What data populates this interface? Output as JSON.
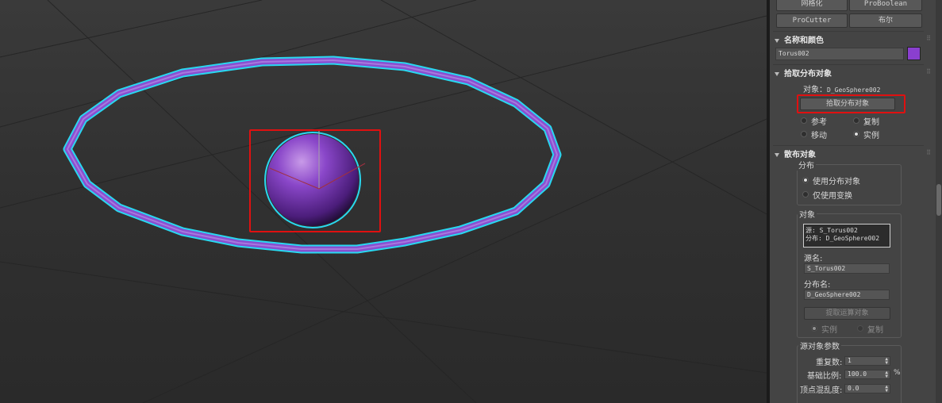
{
  "colors": {
    "viewport_bg": "#333333",
    "panel_bg": "#444444",
    "torus_fill": "#8a4fcf",
    "selection_cyan": "#29d8f0",
    "highlight_red": "#e01010",
    "swatch_purple": "#8a3fcf"
  },
  "top_buttons": {
    "mesh_label": "网格化",
    "proboolean_label": "ProBoolean",
    "procutter_label": "ProCutter",
    "boolean_label": "布尔"
  },
  "name_color": {
    "title": "名称和颜色",
    "object_name": "Torus002"
  },
  "pick_distribution": {
    "title": "拾取分布对象",
    "object_label": "对象：",
    "object_value": "D_GeoSphere002",
    "pick_button": "拾取分布对象",
    "reference_label": "参考",
    "copy_label": "复制",
    "move_label": "移动",
    "instance_label": "实例"
  },
  "scatter_objects": {
    "title": "散布对象",
    "distribution_group": "分布",
    "use_distribution_object": "使用分布对象",
    "use_transforms_only": "仅使用变换",
    "objects_group": "对象",
    "list_line_1": "源: S_Torus002",
    "list_line_2": "分布: D_GeoSphere002",
    "source_name_label": "源名:",
    "source_name_value": "S_Torus002",
    "distribution_name_label": "分布名:",
    "distribution_name_value": "D_GeoSphere002",
    "extract_operand_button": "提取运算对象",
    "instance_label": "实例",
    "copy_label": "复制"
  },
  "source_params": {
    "title": "源对象参数",
    "duplicates_label": "重复数:",
    "duplicates_value": "1",
    "base_scale_label": "基础比例:",
    "base_scale_value": "100.0",
    "base_scale_unit": "%",
    "vertex_chaos_label": "顶点混乱度:",
    "vertex_chaos_value": "0.0"
  }
}
